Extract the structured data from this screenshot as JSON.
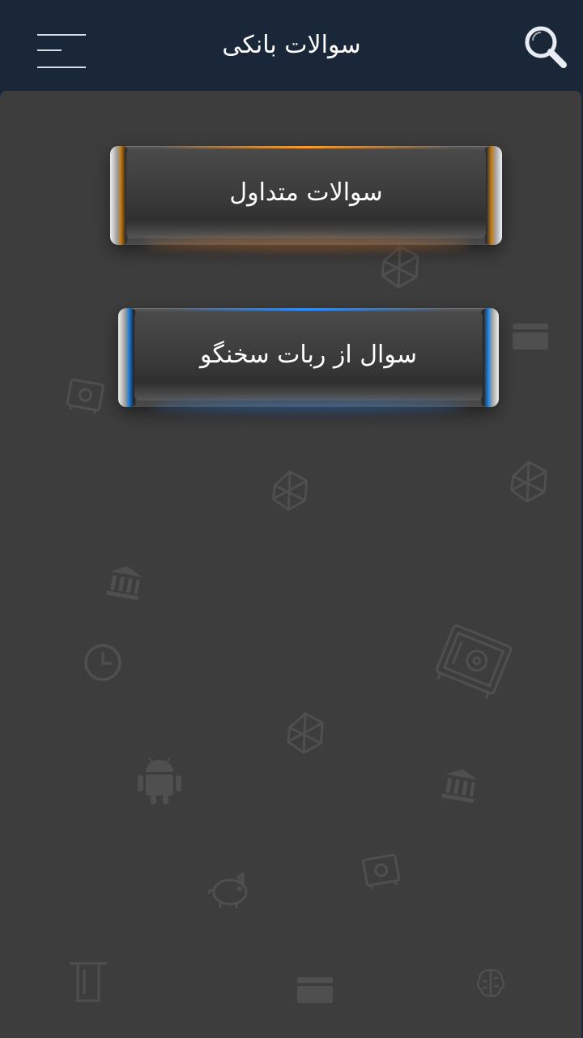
{
  "app_bar": {
    "title": "سوالات بانکی",
    "menu_icon": "hamburger-icon",
    "search_icon": "search-icon"
  },
  "buttons": [
    {
      "label": "سوالات متداول",
      "accent": "#ff9a2a"
    },
    {
      "label": "سوال از ربات سخنگو",
      "accent": "#2e8dff"
    }
  ],
  "background_icons": [
    "network-icon",
    "card-icon",
    "safe-icon",
    "bank-icon",
    "clock-icon",
    "android-icon",
    "piggy-bank-icon",
    "atm-icon",
    "brain-icon"
  ],
  "colors": {
    "app_bar": "#1a2739",
    "content_bg": "#3d3d3d",
    "text": "#ffffff"
  }
}
